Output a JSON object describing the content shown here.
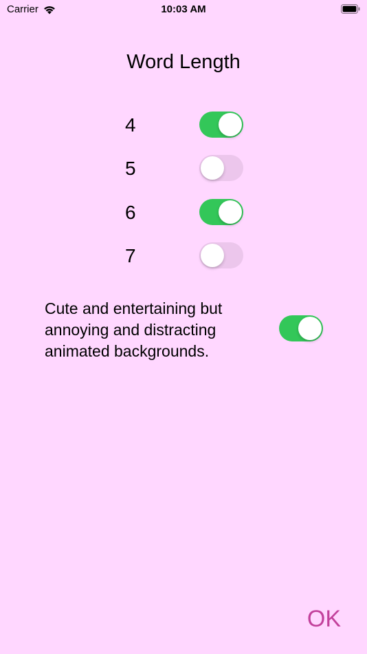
{
  "status_bar": {
    "carrier": "Carrier",
    "time": "10:03 AM"
  },
  "title": "Word Length",
  "word_lengths": [
    {
      "label": "4",
      "on": true
    },
    {
      "label": "5",
      "on": false
    },
    {
      "label": "6",
      "on": true
    },
    {
      "label": "7",
      "on": false
    }
  ],
  "animated_backgrounds": {
    "label": "Cute and entertaining but annoying and distracting animated backgrounds.",
    "on": true
  },
  "ok_label": "OK",
  "colors": {
    "background": "#ffd7ff",
    "switch_on": "#33c759",
    "switch_off": "#ecc6ec",
    "ok": "#c2409b"
  }
}
